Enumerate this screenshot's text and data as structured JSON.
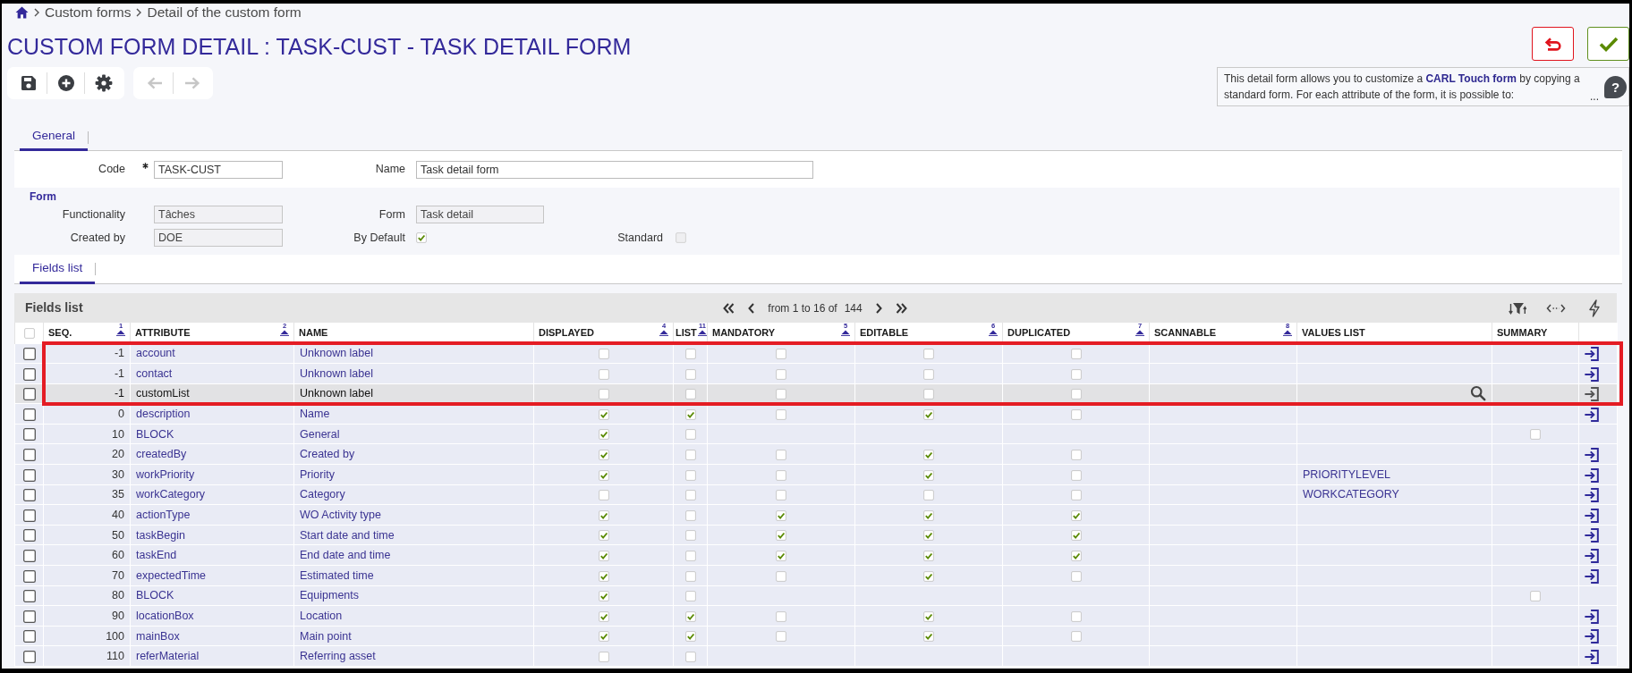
{
  "breadcrumb": {
    "items": [
      {
        "label": "Custom forms"
      },
      {
        "label": "Detail of the custom form"
      }
    ]
  },
  "title": "CUSTOM FORM DETAIL : TASK-CUST - TASK DETAIL FORM",
  "toolbar": [
    {
      "buttons": [
        {
          "kind": "save",
          "disabled": false
        },
        {
          "kind": "add",
          "disabled": false
        },
        {
          "kind": "settings",
          "disabled": false
        }
      ]
    },
    {
      "buttons": [
        {
          "kind": "back",
          "disabled": true
        },
        {
          "kind": "forward",
          "disabled": true
        }
      ]
    }
  ],
  "help": {
    "text": "This detail form allows you to customize a **CARL Touch form** by copying a standard form. For each attribute of the form, it is possible to:",
    "more": "...",
    "button": "?"
  },
  "tabs": [
    {
      "label": "General",
      "selected": true
    }
  ],
  "general_fields": [
    {
      "label": "Code",
      "kind": "text",
      "value": "TASK-CUST",
      "required": true,
      "readonly": false
    },
    {
      "label": "Name",
      "kind": "text",
      "value": "Task detail form",
      "required": false,
      "readonly": false
    }
  ],
  "form_section": {
    "title": "Form",
    "rows": [
      [
        {
          "label": "Functionality",
          "kind": "text",
          "value": "Tâches",
          "readonly": true
        },
        {
          "label": "Form",
          "kind": "text",
          "value": "Task detail",
          "readonly": true
        }
      ],
      [
        {
          "label": "Created by",
          "kind": "text",
          "value": "DOE",
          "readonly": true
        },
        {
          "label": "By Default",
          "kind": "checkbox",
          "checked": true,
          "disabled": false
        },
        {
          "label": "Standard",
          "kind": "checkbox",
          "checked": false,
          "disabled": true
        }
      ]
    ]
  },
  "list_tabs": [
    {
      "label": "Fields list",
      "selected": true
    }
  ],
  "table": {
    "title": "Fields list",
    "pager": {
      "range": "from 1 to 16 of",
      "total": "144"
    },
    "select_all": false,
    "columns": [
      {
        "label": "SEQ.",
        "sort_rank": "1"
      },
      {
        "label": "ATTRIBUTE",
        "sort_rank": "2"
      },
      {
        "label": "NAME"
      },
      {
        "label": "DISPLAYED",
        "sort_rank": "4"
      },
      {
        "label": "LIST",
        "sort_rank": "11"
      },
      {
        "label": "MANDATORY",
        "sort_rank": "5"
      },
      {
        "label": "EDITABLE",
        "sort_rank": "6"
      },
      {
        "label": "DUPLICATED",
        "sort_rank": "7"
      },
      {
        "label": "SCANNABLE",
        "sort_rank": "8"
      },
      {
        "label": "VALUES LIST"
      },
      {
        "label": "SUMMARY"
      }
    ],
    "rows": [
      {
        "selected": false,
        "seq": "-1",
        "attribute": "account",
        "name": "Unknown label",
        "displayed": false,
        "list": false,
        "mandatory": false,
        "editable": false,
        "duplicated": false,
        "action": true,
        "highlighted": true,
        "hovered": false
      },
      {
        "selected": false,
        "seq": "-1",
        "attribute": "contact",
        "name": "Unknown label",
        "displayed": false,
        "list": false,
        "mandatory": false,
        "editable": false,
        "duplicated": false,
        "action": true,
        "highlighted": true,
        "hovered": false
      },
      {
        "selected": false,
        "seq": "-1",
        "attribute": "customList",
        "name": "Unknown label",
        "displayed": false,
        "list": false,
        "mandatory": false,
        "editable": false,
        "duplicated": false,
        "action": true,
        "highlighted": true,
        "hovered": true
      },
      {
        "selected": false,
        "seq": "0",
        "attribute": "description",
        "name": "Name",
        "displayed": true,
        "list": true,
        "mandatory": false,
        "editable": true,
        "duplicated": false,
        "action": true,
        "highlighted": false,
        "hovered": false
      },
      {
        "selected": false,
        "seq": "10",
        "attribute": "BLOCK",
        "name": "General",
        "displayed": true,
        "list": false,
        "summary": false,
        "action": false,
        "highlighted": false,
        "hovered": false
      },
      {
        "selected": false,
        "seq": "20",
        "attribute": "createdBy",
        "name": "Created by",
        "displayed": true,
        "list": false,
        "mandatory": false,
        "editable": true,
        "duplicated": false,
        "action": true,
        "highlighted": false,
        "hovered": false
      },
      {
        "selected": false,
        "seq": "30",
        "attribute": "workPriority",
        "name": "Priority",
        "displayed": true,
        "list": false,
        "mandatory": false,
        "editable": true,
        "duplicated": false,
        "values_list": "PRIORITYLEVEL",
        "action": true,
        "highlighted": false,
        "hovered": false
      },
      {
        "selected": false,
        "seq": "35",
        "attribute": "workCategory",
        "name": "Category",
        "displayed": false,
        "list": false,
        "mandatory": false,
        "editable": false,
        "duplicated": false,
        "values_list": "WORKCATEGORY",
        "action": true,
        "highlighted": false,
        "hovered": false
      },
      {
        "selected": false,
        "seq": "40",
        "attribute": "actionType",
        "name": "WO Activity type",
        "displayed": true,
        "list": false,
        "mandatory": true,
        "editable": true,
        "duplicated": true,
        "action": true,
        "highlighted": false,
        "hovered": false
      },
      {
        "selected": false,
        "seq": "50",
        "attribute": "taskBegin",
        "name": "Start date and time",
        "displayed": true,
        "list": false,
        "mandatory": true,
        "editable": true,
        "duplicated": true,
        "action": true,
        "highlighted": false,
        "hovered": false
      },
      {
        "selected": false,
        "seq": "60",
        "attribute": "taskEnd",
        "name": "End date and time",
        "displayed": true,
        "list": false,
        "mandatory": true,
        "editable": true,
        "duplicated": true,
        "action": true,
        "highlighted": false,
        "hovered": false
      },
      {
        "selected": false,
        "seq": "70",
        "attribute": "expectedTime",
        "name": "Estimated time",
        "displayed": true,
        "list": false,
        "mandatory": false,
        "editable": true,
        "duplicated": false,
        "action": true,
        "highlighted": false,
        "hovered": false
      },
      {
        "selected": false,
        "seq": "80",
        "attribute": "BLOCK",
        "name": "Equipments",
        "displayed": true,
        "list": false,
        "summary": false,
        "action": false,
        "highlighted": false,
        "hovered": false
      },
      {
        "selected": false,
        "seq": "90",
        "attribute": "locationBox",
        "name": "Location",
        "displayed": true,
        "list": true,
        "mandatory": false,
        "editable": true,
        "duplicated": false,
        "action": true,
        "highlighted": false,
        "hovered": false
      },
      {
        "selected": false,
        "seq": "100",
        "attribute": "mainBox",
        "name": "Main point",
        "displayed": true,
        "list": true,
        "mandatory": false,
        "editable": true,
        "duplicated": false,
        "action": true,
        "highlighted": false,
        "hovered": false
      },
      {
        "selected": false,
        "seq": "110",
        "attribute": "referMaterial",
        "name": "Referring asset",
        "displayed": false,
        "list": false,
        "action": true,
        "highlighted": false,
        "hovered": false
      }
    ]
  }
}
